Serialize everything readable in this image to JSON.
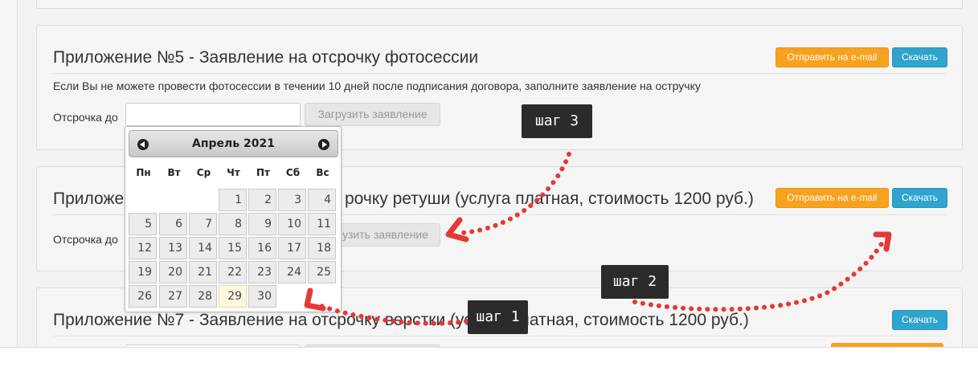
{
  "panel5": {
    "title": "Приложение №5 - Заявление на отсрочку фотосессии",
    "description": "Если Вы не можете провести фотосессии в течении 10 дней после подписания договора, заполните заявление на остручку",
    "label": "Отсрочка до",
    "upload": "Загрузить заявление",
    "email": "Отправить на e-mail",
    "download": "Скачать"
  },
  "panel6": {
    "title_left": "Приложе",
    "title_right": "рочку ретуши (услуга платная, стоимость 1200 руб.)",
    "label": "Отсрочка до",
    "upload": "узить заявление",
    "email": "Отправить на e-mail",
    "download": "Скачать"
  },
  "panel7": {
    "title": "Приложение №7 - Заявление на отсрочку верстки (услуга платная, стоимость 1200 руб.)",
    "download": "Скачать"
  },
  "datepicker": {
    "title": "Апрель 2021",
    "weekdays": [
      "Пн",
      "Вт",
      "Ср",
      "Чт",
      "Пт",
      "Сб",
      "Вс"
    ],
    "first_weekday_index": 3,
    "days_in_month": 30,
    "today": 29
  },
  "callouts": {
    "step1": "шаг 1",
    "step2": "шаг 2",
    "step3": "шаг 3"
  },
  "colors": {
    "email_button": "#f7a21f",
    "download_button": "#2fa4cc",
    "arrow": "#e53935",
    "callout": "#2b2b2b"
  }
}
